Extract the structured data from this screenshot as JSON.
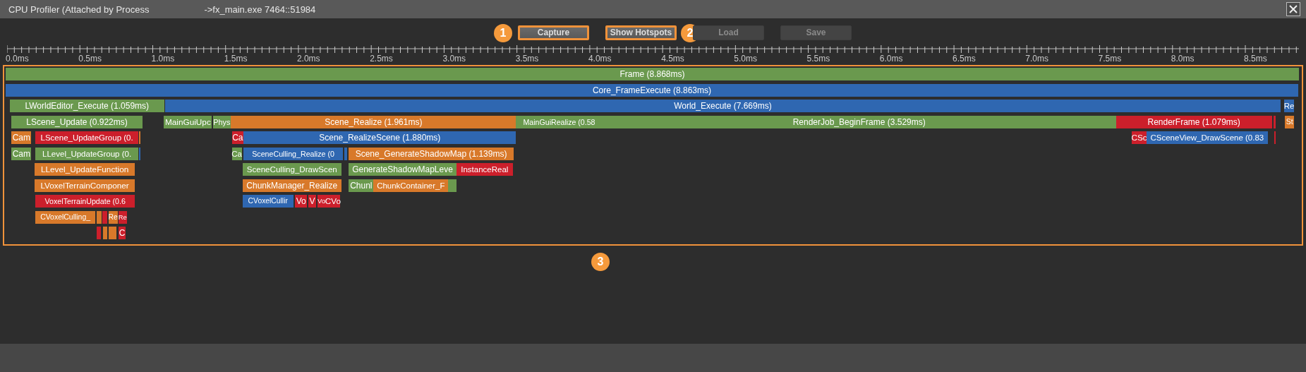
{
  "window": {
    "title": "CPU Profiler (Attached by Process",
    "process": "->fx_main.exe 7464::51984"
  },
  "toolbar": [
    {
      "label": "Capture",
      "disabled": false,
      "highlighted": true,
      "callout": "1"
    },
    {
      "label": "Show Hotspots",
      "disabled": false,
      "highlighted": true,
      "callout": "2"
    },
    {
      "label": "Load",
      "disabled": true,
      "highlighted": false
    },
    {
      "label": "Save",
      "disabled": true,
      "highlighted": false
    }
  ],
  "ruler": {
    "ticks": [
      "0.0ms",
      "0.5ms",
      "1.0ms",
      "1.5ms",
      "2.0ms",
      "2.5ms",
      "3.0ms",
      "3.5ms",
      "4.0ms",
      "4.5ms",
      "5.0ms",
      "5.5ms",
      "6.0ms",
      "6.5ms",
      "7.0ms",
      "7.5ms",
      "8.0ms",
      "8.5ms"
    ]
  },
  "flame": {
    "callout": "3",
    "rows": [
      {
        "bars": [
          {
            "label": "Frame (8.868ms)",
            "color": "#6a994e"
          }
        ]
      },
      {
        "bars": [
          {
            "label": "Core_FrameExecute (8.863ms)",
            "color": "#2f67b1"
          }
        ]
      },
      {
        "bars": [
          {
            "label": "LWorldEditor_Execute (1.059ms)",
            "color": "#6a994e"
          },
          {
            "label": "World_Execute (7.669ms)",
            "color": "#2f67b1"
          },
          {
            "label": "Re",
            "color": "#2f67b1"
          }
        ]
      },
      {
        "bars": [
          {
            "label": "LScene_Update (0.922ms)",
            "color": "#6a994e"
          },
          {
            "label": "MainGuiUpc",
            "color": "#6a994e"
          },
          {
            "label": "Phys",
            "color": "#6a994e"
          },
          {
            "label": "Scene_Realize (1.961ms)",
            "color": "#d8792a"
          },
          {
            "label": "MainGuiRealize (0.58",
            "color": "#6a994e"
          },
          {
            "label": "RenderJob_BeginFrame (3.529ms)",
            "color": "#6a994e"
          },
          {
            "label": "RenderFrame (1.079ms)",
            "color": "#cc1f2b"
          },
          {
            "color": "#cc1f2b"
          },
          {
            "label": "St",
            "color": "#d8792a"
          }
        ]
      },
      {
        "bars": [
          {
            "label": "Cam",
            "color": "#d8792a"
          },
          {
            "label": "LScene_UpdateGroup (0.",
            "color": "#cc1f2b"
          },
          {
            "color": "#d8792a"
          },
          {
            "label": "Ca",
            "color": "#cc1f2b"
          },
          {
            "label": "Scene_RealizeScene (1.880ms)",
            "color": "#2f67b1"
          },
          {
            "label": "CSc",
            "color": "#cc1f2b"
          },
          {
            "label": "CSceneView_DrawScene (0.83",
            "color": "#2f67b1"
          },
          {
            "color": "#cc1f2b"
          }
        ]
      },
      {
        "bars": [
          {
            "label": "Cam",
            "color": "#6a994e"
          },
          {
            "label": "LLevel_UpdateGroup (0.",
            "color": "#6a994e"
          },
          {
            "color": "#2f67b1"
          },
          {
            "label": "Ca",
            "color": "#6a994e"
          },
          {
            "label": "SceneCulling_Realize (0",
            "color": "#2f67b1"
          },
          {
            "color": "#2f67b1"
          },
          {
            "label": "Scene_GenerateShadowMap (1.139ms)",
            "color": "#d8792a"
          }
        ]
      },
      {
        "bars": [
          {
            "label": "LLevel_UpdateFunction",
            "color": "#d8792a"
          },
          {
            "label": "SceneCulling_DrawScen",
            "color": "#6a994e"
          },
          {
            "label": "GenerateShadowMapLeve",
            "color": "#6a994e"
          },
          {
            "label": "InstanceReal",
            "color": "#cc1f2b"
          }
        ]
      },
      {
        "bars": [
          {
            "label": "LVoxelTerrainComponer",
            "color": "#d8792a"
          },
          {
            "label": "ChunkManager_Realize",
            "color": "#d8792a"
          },
          {
            "label": "Chunl",
            "color": "#6a994e"
          },
          {
            "label": "ChunkContainer_F",
            "color": "#d8792a"
          },
          {
            "color": "#6a994e"
          }
        ]
      },
      {
        "bars": [
          {
            "label": "VoxelTerrainUpdate (0.6",
            "color": "#cc1f2b"
          },
          {
            "label": "CVoxelCullir",
            "color": "#2f67b1"
          },
          {
            "label": "Vo",
            "color": "#cc1f2b"
          },
          {
            "label": "V",
            "color": "#cc1f2b"
          },
          {
            "label": "Vo",
            "color": "#cc1f2b"
          },
          {
            "label": "CVo",
            "color": "#cc1f2b"
          }
        ]
      },
      {
        "bars": [
          {
            "label": "CVoxelCulling_",
            "color": "#d8792a"
          },
          {
            "color": "#d8792a"
          },
          {
            "color": "#cc1f2b"
          },
          {
            "label": "Re",
            "color": "#d8792a"
          },
          {
            "label": "Re",
            "color": "#cc1f2b"
          }
        ]
      },
      {
        "bars": [
          {
            "color": "#cc1f2b"
          },
          {
            "color": "#d8792a"
          },
          {
            "color": "#d8792a"
          },
          {
            "label": "C",
            "color": "#cc1f2b"
          }
        ]
      }
    ]
  }
}
